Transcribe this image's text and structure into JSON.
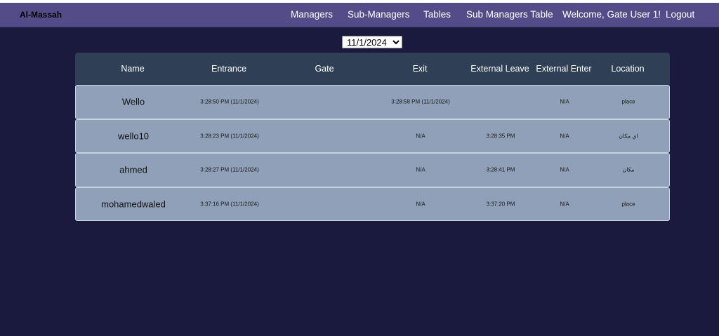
{
  "nav": {
    "brand": "Al-Massah",
    "links": [
      "Managers",
      "Sub-Managers",
      "Tables",
      "Sub Managers Table",
      "Welcome, Gate User 1!",
      "Logout"
    ]
  },
  "date_select": {
    "selected": "11/1/2024"
  },
  "table": {
    "headers": [
      "Name",
      "Entrance",
      "Gate",
      "Exit",
      "External Leave",
      "External Enter",
      "Location"
    ],
    "rows": [
      {
        "name": "Wello",
        "entrance": "3:28:50 PM (11/1/2024)",
        "gate": "",
        "exit": "3:28:58 PM (11/1/2024)",
        "external_leave": "",
        "external_enter": "N/A",
        "location": "place"
      },
      {
        "name": "wello10",
        "entrance": "3:28:23 PM (11/1/2024)",
        "gate": "",
        "exit": "N/A",
        "external_leave": "3:28:35 PM",
        "external_enter": "N/A",
        "location": "اي مكان"
      },
      {
        "name": "ahmed",
        "entrance": "3:28:27 PM (11/1/2024)",
        "gate": "",
        "exit": "N/A",
        "external_leave": "3:28:41 PM",
        "external_enter": "N/A",
        "location": "مكان"
      },
      {
        "name": "mohamedwaled",
        "entrance": "3:37:16 PM (11/1/2024)",
        "gate": "",
        "exit": "N/A",
        "external_leave": "3:37:20 PM",
        "external_enter": "N/A",
        "location": "place"
      }
    ]
  },
  "colors": {
    "page_background": "#1a1a3e",
    "navbar": "#544c89",
    "table_header": "#2f3f55",
    "table_row": "#8fa0b8"
  }
}
